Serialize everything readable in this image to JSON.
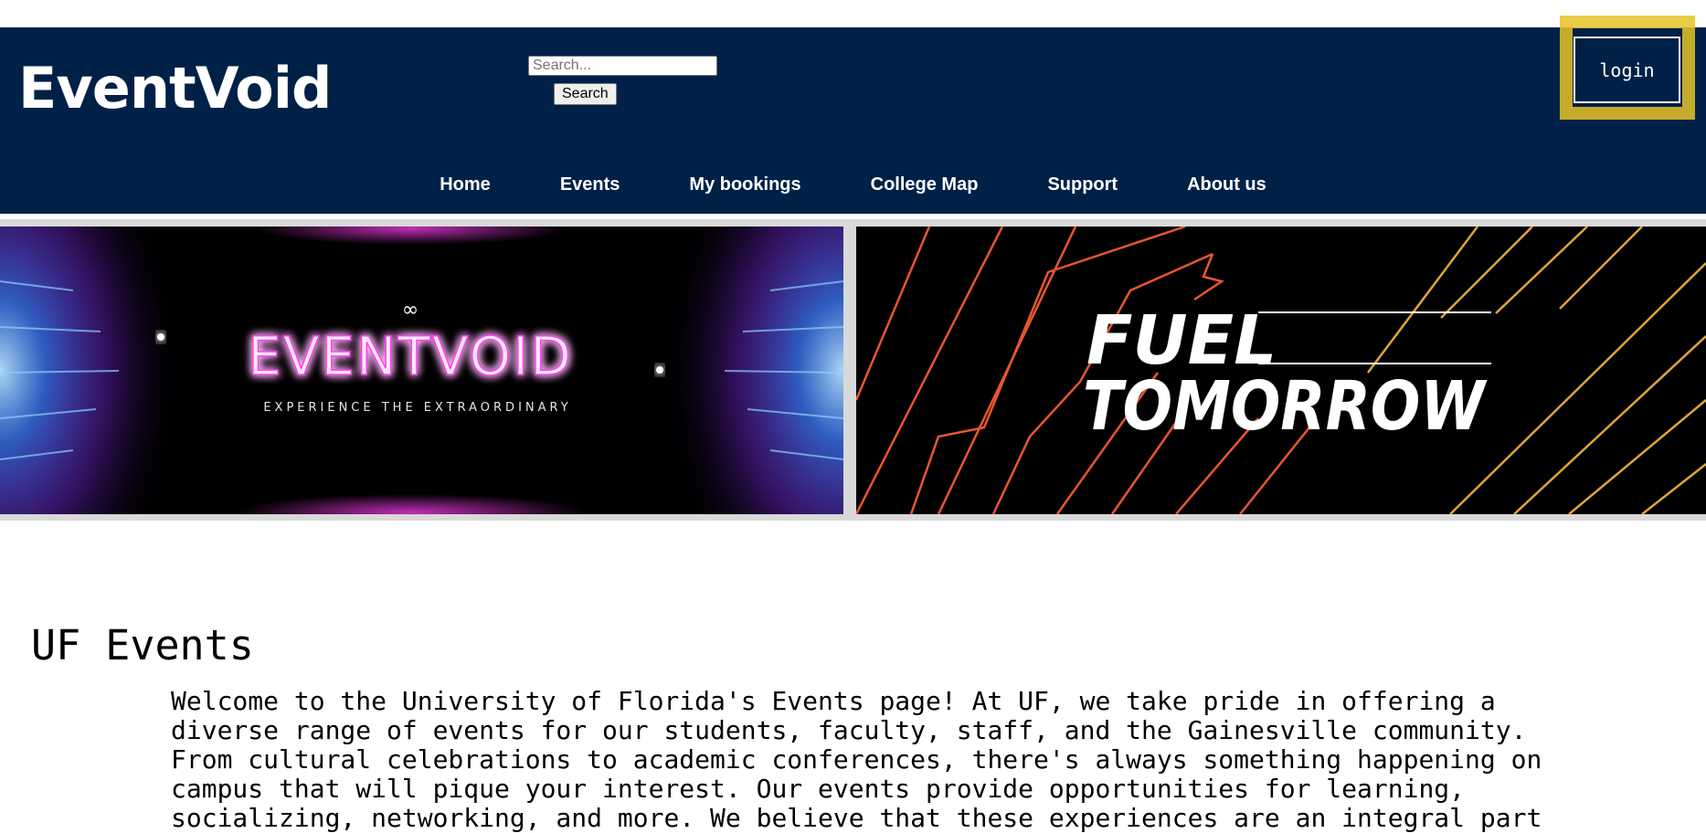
{
  "header": {
    "brand": "EventVoid",
    "search_placeholder": "Search...",
    "search_value": "",
    "search_button": "Search",
    "login_label": "login",
    "nav": [
      "Home",
      "Events",
      "My bookings",
      "College Map",
      "Support",
      "About us"
    ]
  },
  "banners": {
    "left": {
      "symbol": "∞",
      "title": "EVENTVOID",
      "tagline": "EXPERIENCE THE EXTRAORDINARY"
    },
    "right": {
      "line1": "FUEL",
      "line2": "TOMORROW"
    }
  },
  "main": {
    "title": "UF Events",
    "intro": "Welcome to the University of Florida's Events page! At UF, we take pride in offering a\ndiverse range of events for our students, faculty, staff, and the Gainesville community.\nFrom cultural celebrations to academic conferences, there's always something happening on\ncampus that will pique your interest. Our events provide opportunities for learning,\nsocializing, networking, and more. We believe that these experiences are an integral part"
  },
  "colors": {
    "header_bg": "#002147",
    "highlight": "#e6c328",
    "neon_pink": "#ff3df2",
    "fuel_orange": "#e8562e"
  }
}
